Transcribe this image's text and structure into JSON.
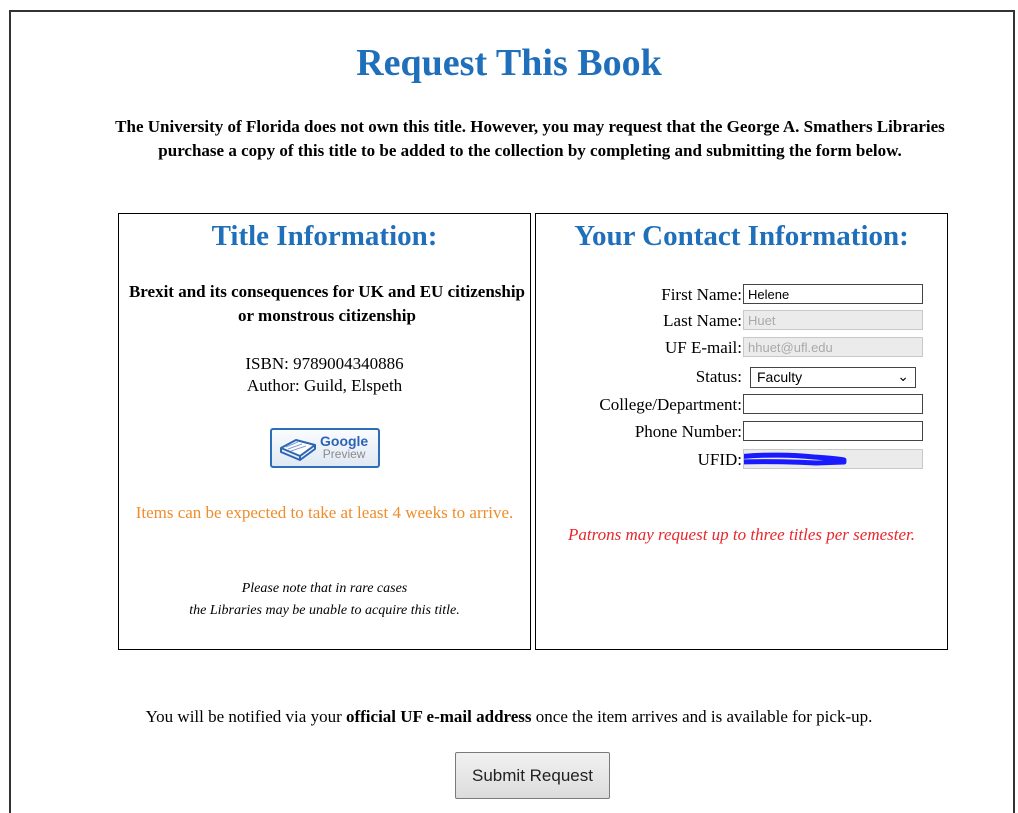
{
  "page": {
    "title": "Request This Book",
    "intro": "The University of Florida does not own this title. However, you may request that the George A. Smathers Libraries purchase a copy of this title to be added to the collection by completing and submitting the form below."
  },
  "title_info": {
    "heading": "Title Information:",
    "book_title": "Brexit and its consequences for UK and EU citizenship or monstrous citizenship",
    "isbn": "ISBN: 9789004340886",
    "author": "Author: Guild, Elspeth",
    "google_preview": {
      "line1": "Google",
      "line2": "Preview"
    },
    "arrival_notice": "Items can be expected to take at least 4 weeks to arrive.",
    "rare_note_line1": "Please note that in rare cases",
    "rare_note_line2": "the Libraries may be unable to acquire this title."
  },
  "contact": {
    "heading": "Your Contact Information:",
    "first_name_label": "First Name:",
    "first_name_value": "Helene",
    "last_name_label": "Last Name:",
    "last_name_value": "Huet",
    "email_label": "UF E-mail:",
    "email_value": "hhuet@ufl.edu",
    "status_label": "Status:",
    "status_value": "Faculty",
    "college_label": "College/Department:",
    "college_value": "",
    "phone_label": "Phone Number:",
    "phone_value": "",
    "ufid_label": "UFID:",
    "patrons_notice": "Patrons may request up to three titles per semester."
  },
  "footer": {
    "notify_pre": "You will be notified via your ",
    "notify_bold": "official UF e-mail address",
    "notify_post": " once the item arrives and is available for pick-up.",
    "submit_label": "Submit Request"
  },
  "colors": {
    "heading_blue": "#1f6fba",
    "notice_orange": "#ee8d2c",
    "notice_red": "#e8262c",
    "redaction_blue": "#1a1aff"
  }
}
